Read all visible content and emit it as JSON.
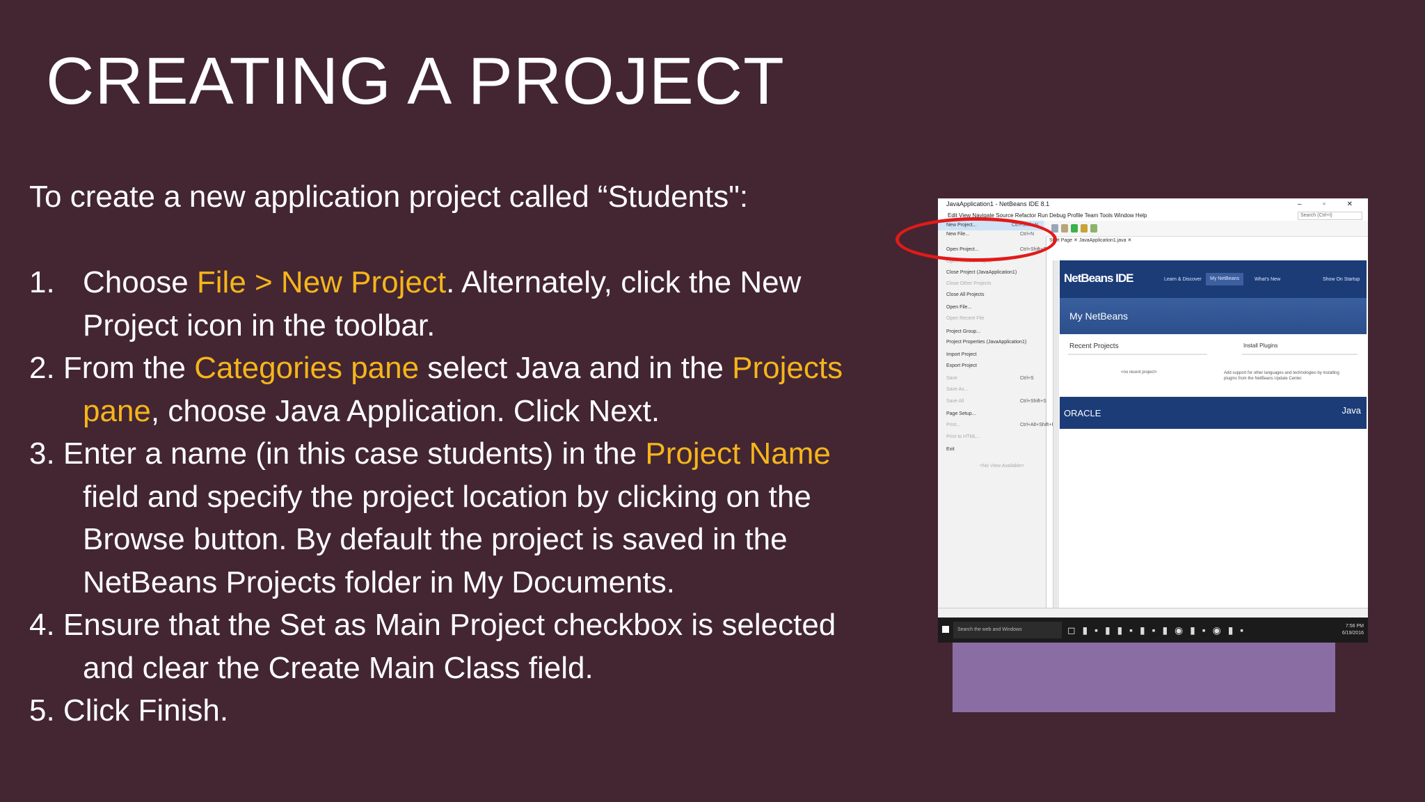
{
  "slide": {
    "title": "CREATING A PROJECT",
    "intro": "To create a new application project called “Students\":",
    "step1": {
      "num": "1.",
      "pre": "Choose ",
      "hl": "File > New Project",
      "post": ". Alternately, click the New",
      "cont": "Project icon in the toolbar."
    },
    "step2": {
      "pre": "2. From the ",
      "hl1": "Categories pane",
      "mid": " select Java and in the ",
      "hl2a": "Projects",
      "hl2b": "pane",
      "cont": ", choose Java Application. Click Next."
    },
    "step3": {
      "pre": "3. Enter a name (in this case students) in the ",
      "hl": "Project Name",
      "cont1": "field and specify the project location by clicking on the",
      "cont2": "Browse button. By default the project is saved in the",
      "cont3": "NetBeans Projects folder in My Documents."
    },
    "step4": {
      "line1": "4. Ensure that the Set as Main Project checkbox is selected",
      "cont": "and clear the Create Main Class field."
    },
    "step5": {
      "line1": "5. Click Finish."
    }
  },
  "screenshot": {
    "window_title": "JavaApplication1 - NetBeans IDE 8.1",
    "window_controls": "–  ▫  ✕",
    "menubar": "Edit  View  Navigate  Source  Refactor  Run  Debug  Profile  Team  Tools  Window  Help",
    "search_placeholder": "Search (Ctrl+I)",
    "file_menu": [
      {
        "label": "New Project...",
        "shortcut": "Ctrl+Shift+N",
        "selected": true
      },
      {
        "label": "New File...",
        "shortcut": "Ctrl+N"
      },
      {
        "label": "Open Project...",
        "shortcut": "Ctrl+Shift+O"
      },
      {
        "label": "Open Recent Project",
        "dim": true
      },
      {
        "label": "Close Project (JavaApplication1)"
      },
      {
        "label": "Close Other Projects",
        "dim": true
      },
      {
        "label": "Close All Projects"
      },
      {
        "label": "Open File..."
      },
      {
        "label": "Open Recent File",
        "dim": true
      },
      {
        "label": "Project Group..."
      },
      {
        "label": "Project Properties (JavaApplication1)"
      },
      {
        "label": "Import Project"
      },
      {
        "label": "Export Project"
      },
      {
        "label": "Save",
        "shortcut": "Ctrl+S",
        "dim": true
      },
      {
        "label": "Save As...",
        "dim": true
      },
      {
        "label": "Save All",
        "shortcut": "Ctrl+Shift+S",
        "dim": true
      },
      {
        "label": "Page Setup..."
      },
      {
        "label": "Print...",
        "shortcut": "Ctrl+Alt+Shift+P",
        "dim": true
      },
      {
        "label": "Print to HTML...",
        "dim": true
      },
      {
        "label": "Exit"
      },
      {
        "label": "<No View Available>",
        "dim": true
      }
    ],
    "tabs": "Start Page  ✕   JavaApplication1.java  ✕",
    "netbeans_logo": "NetBeans IDE",
    "nav": {
      "learn": "Learn & Discover",
      "my": "My NetBeans",
      "whats_new": "What's New",
      "show_startup": "Show On Startup"
    },
    "banner_title": "My NetBeans",
    "recent_projects": "Recent Projects",
    "install_plugins": "Install Plugins",
    "no_recent": "<no recent project>",
    "plugins_desc": "Add support for other languages and technologies by installing plugins from the NetBeans Update Center.",
    "oracle": "ORACLE",
    "java": "Java",
    "taskbar_search": "Search the web and Windows",
    "clock_time": "7:56 PM",
    "clock_date": "6/19/2016",
    "colors": {
      "background": "#432632",
      "highlight": "#f5b51c",
      "netbeans_blue": "#1c3c78",
      "annotation_red": "#e21a1a",
      "accent_box": "#8a6da3"
    }
  }
}
